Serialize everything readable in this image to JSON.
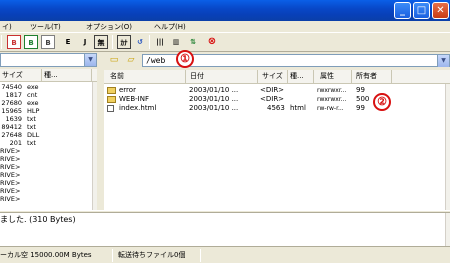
{
  "titlebar": {
    "minimize": "_",
    "maximize": "□",
    "close": "✕"
  },
  "menu": {
    "items": [
      "イ)",
      "ツール(T)",
      "オプション(O)",
      "ヘルプ(H)"
    ]
  },
  "toolbar": {
    "buttons": [
      {
        "icon": "b-red-icon",
        "label": "B"
      },
      {
        "icon": "b-green-icon",
        "label": "B"
      },
      {
        "icon": "b-gray-icon",
        "label": "B"
      },
      {
        "icon": "euc-icon",
        "label": "E"
      },
      {
        "icon": "jis-icon",
        "label": "J"
      },
      {
        "icon": "none-icon",
        "label": "無"
      },
      {
        "icon": "kana-icon",
        "label": "ｶﾅ"
      },
      {
        "icon": "refresh-icon",
        "label": "↺"
      },
      {
        "icon": "columns-icon",
        "label": "|||"
      },
      {
        "icon": "list-icon",
        "label": "▥"
      },
      {
        "icon": "sync-icon",
        "label": "⇅"
      },
      {
        "icon": "stop-icon",
        "label": "⊗"
      }
    ]
  },
  "left_panel": {
    "columns": [
      "サイズ",
      "種..."
    ],
    "rows": [
      {
        "size": "74540",
        "type": "exe"
      },
      {
        "size": "1817",
        "type": "cnt"
      },
      {
        "size": "27680",
        "type": "exe"
      },
      {
        "size": "15965",
        "type": "HLP"
      },
      {
        "size": "1639",
        "type": "txt"
      },
      {
        "size": "89412",
        "type": "txt"
      },
      {
        "size": "27648",
        "type": "DLL"
      },
      {
        "size": "201",
        "type": "txt"
      },
      {
        "size": "RIVE>",
        "type": ""
      },
      {
        "size": "RIVE>",
        "type": ""
      },
      {
        "size": "RIVE>",
        "type": ""
      },
      {
        "size": "RIVE>",
        "type": ""
      },
      {
        "size": "RIVE>",
        "type": ""
      },
      {
        "size": "RIVE>",
        "type": ""
      },
      {
        "size": "RIVE>",
        "type": ""
      }
    ]
  },
  "right_panel": {
    "path": "/web",
    "columns": [
      "名前",
      "日付",
      "サイズ",
      "種...",
      "属性",
      "所有者"
    ],
    "rows": [
      {
        "icon": "folder-icon",
        "name": "error",
        "date": "2003/01/10 ...",
        "size": "<DIR>",
        "type": "",
        "attr": "rwxrwxr...",
        "owner": "99"
      },
      {
        "icon": "folder-icon",
        "name": "WEB-INF",
        "date": "2003/01/10 ...",
        "size": "<DIR>",
        "type": "",
        "attr": "rwxrwxr...",
        "owner": "500"
      },
      {
        "icon": "file-icon",
        "name": "index.html",
        "date": "2003/01/10 ...",
        "size": "4563",
        "type": "html",
        "attr": "rw-rw-r...",
        "owner": "99"
      }
    ]
  },
  "callouts": [
    "①",
    "②"
  ],
  "log": {
    "text": "ました. (310 Bytes)"
  },
  "status": {
    "local_free": "ーカル空 15000.00M Bytes",
    "queue": "転送待ちファイル0個"
  }
}
